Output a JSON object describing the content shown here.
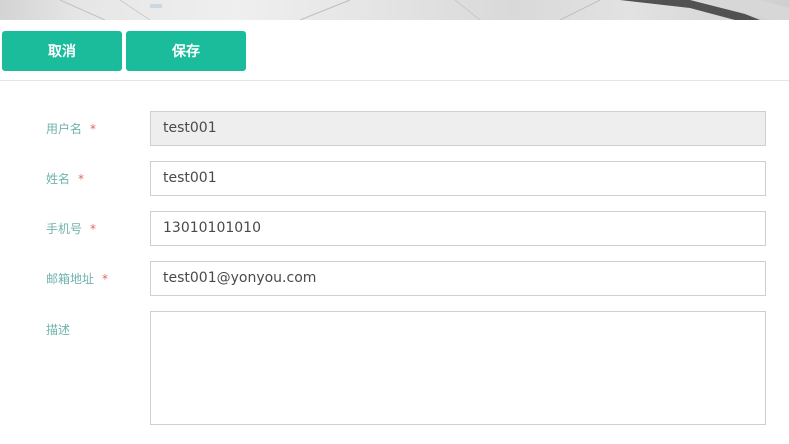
{
  "toolbar": {
    "cancel_label": "取消",
    "save_label": "保存"
  },
  "form": {
    "username": {
      "label": "用户名",
      "required_mark": "*",
      "value": "test001",
      "disabled": true
    },
    "name": {
      "label": "姓名",
      "required_mark": "*",
      "value": "test001"
    },
    "phone": {
      "label": "手机号",
      "required_mark": "*",
      "value": "13010101010"
    },
    "email": {
      "label": "邮箱地址",
      "required_mark": "*",
      "value": "test001@yonyou.com"
    },
    "description": {
      "label": "描述",
      "value": ""
    }
  },
  "colors": {
    "accent": "#1bbc9b",
    "label": "#6fb3ad",
    "required": "#e0686a"
  }
}
